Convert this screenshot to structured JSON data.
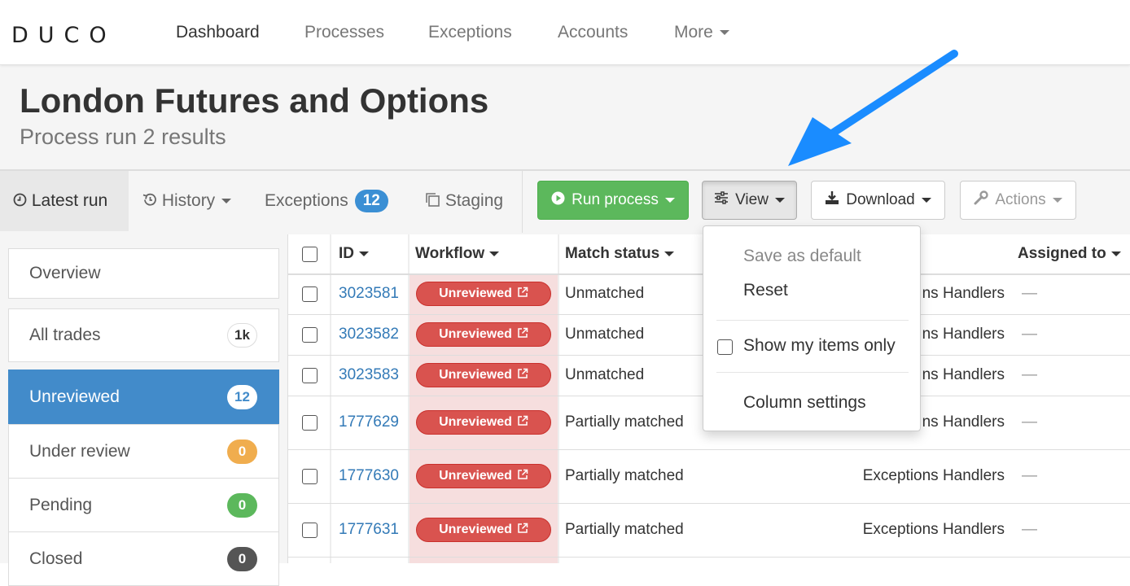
{
  "nav": {
    "logo": "DUCO",
    "items": [
      "Dashboard",
      "Processes",
      "Exceptions",
      "Accounts",
      "More"
    ]
  },
  "header": {
    "title": "London Futures and Options",
    "subtitle": "Process run 2 results"
  },
  "toolbar": {
    "tabs": {
      "latest_run": "Latest run",
      "history": "History",
      "exceptions": "Exceptions",
      "exceptions_count": "12",
      "staging": "Staging"
    },
    "buttons": {
      "run_process": "Run process",
      "view": "View",
      "download": "Download",
      "actions": "Actions"
    }
  },
  "sidebar": {
    "items": [
      {
        "label": "Overview",
        "count": ""
      },
      {
        "label": "All trades",
        "count": "1k"
      },
      {
        "label": "Unreviewed",
        "count": "12"
      },
      {
        "label": "Under review",
        "count": "0"
      },
      {
        "label": "Pending",
        "count": "0"
      },
      {
        "label": "Closed",
        "count": "0"
      }
    ]
  },
  "table": {
    "headers": {
      "id": "ID",
      "workflow": "Workflow",
      "match_status": "Match status",
      "assigned_to": "Assigned to"
    },
    "rows": [
      {
        "id": "3023581",
        "workflow": "Unreviewed",
        "match_status": "Unmatched",
        "team": "Exceptions Handlers",
        "visible_team": "ns Handlers",
        "assigned": "—"
      },
      {
        "id": "3023582",
        "workflow": "Unreviewed",
        "match_status": "Unmatched",
        "team": "Exceptions Handlers",
        "visible_team": "ns Handlers",
        "assigned": "—"
      },
      {
        "id": "3023583",
        "workflow": "Unreviewed",
        "match_status": "Unmatched",
        "team": "Exceptions Handlers",
        "visible_team": "ns Handlers",
        "assigned": "—"
      },
      {
        "id": "1777629",
        "workflow": "Unreviewed",
        "match_status": "Partially matched",
        "team": "Exceptions Handlers",
        "visible_team": "ns Handlers",
        "assigned": "—"
      },
      {
        "id": "1777630",
        "workflow": "Unreviewed",
        "match_status": "Partially matched",
        "team": "Exceptions Handlers",
        "visible_team": "Exceptions Handlers",
        "assigned": "—"
      },
      {
        "id": "1777631",
        "workflow": "Unreviewed",
        "match_status": "Partially matched",
        "team": "Exceptions Handlers",
        "visible_team": "Exceptions Handlers",
        "assigned": "—"
      }
    ]
  },
  "view_menu": {
    "save_default": "Save as default",
    "reset": "Reset",
    "show_mine": "Show my items only",
    "column_settings": "Column settings"
  },
  "colors": {
    "accent_blue": "#428bca",
    "run_green": "#5cb85c",
    "unreviewed_red": "#d9534f",
    "badge_orange": "#f0ad4e",
    "badge_green": "#5cb85c",
    "badge_dark": "#555555",
    "annotation_arrow": "#1a8cff"
  }
}
